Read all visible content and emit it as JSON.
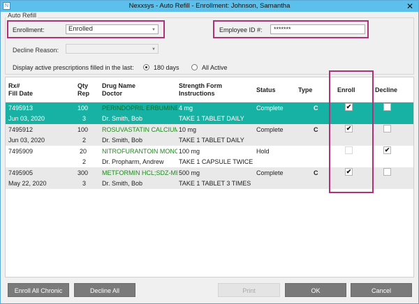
{
  "window": {
    "app_icon": "N",
    "title": "Nexxsys - Auto Refill - Enrollment: Johnson, Samantha",
    "close_glyph": "✕"
  },
  "auto_refill": {
    "legend": "Auto Refill",
    "enrollment_label": "Enrollment:",
    "enrollment_value": "Enrolled",
    "employee_id_label": "Employee ID #:",
    "employee_id_value": "*******",
    "decline_reason_label": "Decline Reason:",
    "decline_reason_value": "",
    "display_label": "Display active prescriptions filled in the last:",
    "option_180": "180 days",
    "option_all": "All Active",
    "selected_option": "180 days"
  },
  "grid": {
    "headers": {
      "rx_line1": "Rx#",
      "rx_line2": "Fill Date",
      "qty_line1": "Qty",
      "qty_line2": "Rep",
      "drug_line1": "Drug Name",
      "drug_line2": "Doctor",
      "strength_line1": "Strength Form",
      "strength_line2": "Instructions",
      "status": "Status",
      "type": "Type",
      "enroll": "Enroll",
      "decline": "Decline"
    },
    "rows": [
      {
        "rx": "7495913",
        "fill_date": "Jun 03, 2020",
        "qty": "100",
        "rep": "3",
        "drug": "PERINDOPRIL ERBUMINE",
        "doctor": "Dr. Smith, Bob",
        "strength": "4 mg",
        "instructions": "TAKE 1 TABLET DAILY",
        "status": "Complete",
        "type": "C",
        "enroll": "✔",
        "decline": ""
      },
      {
        "rx": "7495912",
        "fill_date": "Jun 03, 2020",
        "qty": "100",
        "rep": "2",
        "drug": "ROSUVASTATIN CALCIUM",
        "doctor": "Dr. Smith, Bob",
        "strength": "10 mg",
        "instructions": "TAKE 1 TABLET DAILY",
        "status": "Complete",
        "type": "C",
        "enroll": "✔",
        "decline": ""
      },
      {
        "rx": "7495909",
        "fill_date": "",
        "qty": "20",
        "rep": "2",
        "drug": "NITROFURANTOIN MONC",
        "doctor": "Dr. Propharm, Andrew",
        "strength": "100 mg",
        "instructions": "TAKE 1 CAPSULE TWICE DA",
        "status": "Hold",
        "type": "",
        "enroll": "",
        "decline": "✔"
      },
      {
        "rx": "7495905",
        "fill_date": "May 22, 2020",
        "qty": "300",
        "rep": "3",
        "drug": "METFORMIN HCL;SDZ-ME",
        "doctor": "Dr. Smith, Bob",
        "strength": "500 mg",
        "instructions": "TAKE 1 TABLET 3 TIMES DA",
        "status": "Complete",
        "type": "C",
        "enroll": "✔",
        "decline": ""
      }
    ]
  },
  "buttons": {
    "enroll_all_chronic": "Enroll All Chronic",
    "decline_all": "Decline All",
    "print": "Print",
    "ok": "OK",
    "cancel": "Cancel"
  },
  "colors": {
    "titlebar": "#5bc0eb",
    "selected_row": "#17b2a3",
    "drug_text": "#1f8a1f",
    "highlight_box": "#b0307a",
    "button": "#7a7a7a"
  }
}
